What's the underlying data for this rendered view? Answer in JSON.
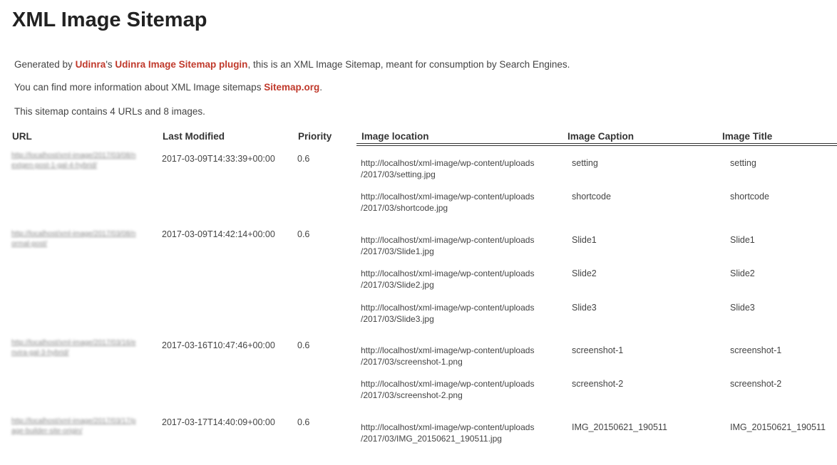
{
  "page": {
    "title": "XML Image Sitemap",
    "intro": {
      "line1_prefix": "Generated by ",
      "author_link": "Udinra",
      "line1_mid": "'s ",
      "plugin_link": "Udinra Image Sitemap plugin",
      "line1_suffix": ", this is an XML Image Sitemap, meant for consumption by Search Engines.",
      "line2_prefix": "You can find more information about XML Image sitemaps ",
      "sitemap_link": "Sitemap.org",
      "line2_suffix": ".",
      "line3": "This sitemap contains 4 URLs and 8 images."
    },
    "link_color": "#c0392b"
  },
  "table": {
    "headers": {
      "url": "URL",
      "modified": "Last Modified",
      "priority": "Priority",
      "location": "Image location",
      "caption": "Image Caption",
      "title": "Image Title"
    },
    "entries": [
      {
        "url": "http://localhost/xml-image/2017/03/08/nextgen-post-1-gal-4-hybrid/",
        "modified": "2017-03-09T14:33:39+00:00",
        "priority": "0.6",
        "images": [
          {
            "loc1": "http://localhost/xml-image/wp-content/uploads",
            "loc2": "/2017/03/setting.jpg",
            "caption": "setting",
            "title": "setting"
          },
          {
            "loc1": "http://localhost/xml-image/wp-content/uploads",
            "loc2": "/2017/03/shortcode.jpg",
            "caption": "shortcode",
            "title": "shortcode"
          }
        ]
      },
      {
        "url": "http://localhost/xml-image/2017/03/08/normal-post/",
        "modified": "2017-03-09T14:42:14+00:00",
        "priority": "0.6",
        "images": [
          {
            "loc1": "http://localhost/xml-image/wp-content/uploads",
            "loc2": "/2017/03/Slide1.jpg",
            "caption": "Slide1",
            "title": "Slide1"
          },
          {
            "loc1": "http://localhost/xml-image/wp-content/uploads",
            "loc2": "/2017/03/Slide2.jpg",
            "caption": "Slide2",
            "title": "Slide2"
          },
          {
            "loc1": "http://localhost/xml-image/wp-content/uploads",
            "loc2": "/2017/03/Slide3.jpg",
            "caption": "Slide3",
            "title": "Slide3"
          }
        ]
      },
      {
        "url": "http://localhost/xml-image/2017/03/16/envira-gal-3-hybrid/",
        "modified": "2017-03-16T10:47:46+00:00",
        "priority": "0.6",
        "images": [
          {
            "loc1": "http://localhost/xml-image/wp-content/uploads",
            "loc2": "/2017/03/screenshot-1.png",
            "caption": "screenshot-1",
            "title": "screenshot-1"
          },
          {
            "loc1": "http://localhost/xml-image/wp-content/uploads",
            "loc2": "/2017/03/screenshot-2.png",
            "caption": "screenshot-2",
            "title": "screenshot-2"
          }
        ]
      },
      {
        "url": "http://localhost/xml-image/2017/03/17/page-builder-site-origin/",
        "modified": "2017-03-17T14:40:09+00:00",
        "priority": "0.6",
        "images": [
          {
            "loc1": "http://localhost/xml-image/wp-content/uploads",
            "loc2": "/2017/03/IMG_20150621_190511.jpg",
            "caption": "IMG_20150621_190511",
            "title": "IMG_20150621_190511"
          }
        ]
      }
    ]
  }
}
